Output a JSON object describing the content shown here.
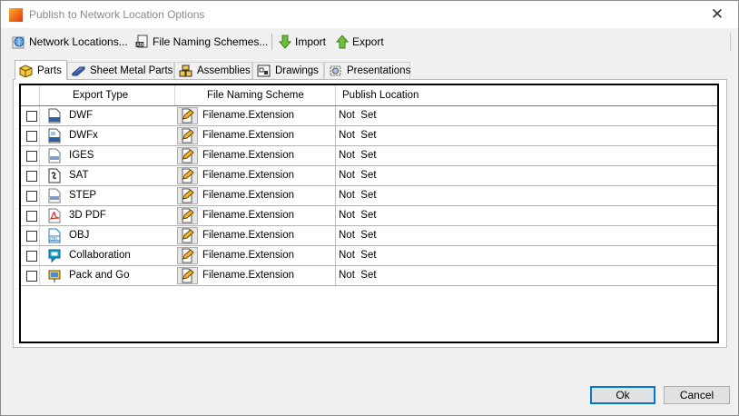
{
  "window": {
    "title": "Publish to Network Location Options",
    "close_glyph": "✕"
  },
  "toolbar": {
    "items": [
      {
        "label": "Network Locations...",
        "icon": "network-location-icon"
      },
      {
        "label": "File Naming Schemes...",
        "icon": "file-naming-icon"
      },
      {
        "label": "Import",
        "icon": "import-arrow-icon"
      },
      {
        "label": "Export",
        "icon": "export-arrow-icon"
      }
    ]
  },
  "tabs": [
    {
      "label": "Parts",
      "icon": "part-cube-icon",
      "active": true
    },
    {
      "label": "Sheet Metal Parts",
      "icon": "sheet-metal-icon",
      "active": false
    },
    {
      "label": "Assemblies",
      "icon": "assembly-icon",
      "active": false
    },
    {
      "label": "Drawings",
      "icon": "drawing-icon",
      "active": false
    },
    {
      "label": "Presentations",
      "icon": "presentation-icon",
      "active": false
    }
  ],
  "table": {
    "columns": [
      "Export Type",
      "File Naming Scheme",
      "Publish Location"
    ],
    "rows": [
      {
        "checked": false,
        "icon": "dwf-file-icon",
        "type": "DWF",
        "scheme": "Filename.Extension",
        "location": "Not  Set"
      },
      {
        "checked": false,
        "icon": "dwfx-file-icon",
        "type": "DWFx",
        "scheme": "Filename.Extension",
        "location": "Not  Set"
      },
      {
        "checked": false,
        "icon": "iges-file-icon",
        "type": "IGES",
        "scheme": "Filename.Extension",
        "location": "Not  Set"
      },
      {
        "checked": false,
        "icon": "sat-file-icon",
        "type": "SAT",
        "scheme": "Filename.Extension",
        "location": "Not  Set"
      },
      {
        "checked": false,
        "icon": "step-file-icon",
        "type": "STEP",
        "scheme": "Filename.Extension",
        "location": "Not  Set"
      },
      {
        "checked": false,
        "icon": "pdf-file-icon",
        "type": "3D PDF",
        "scheme": "Filename.Extension",
        "location": "Not  Set"
      },
      {
        "checked": false,
        "icon": "obj-file-icon",
        "type": "OBJ",
        "scheme": "Filename.Extension",
        "location": "Not  Set"
      },
      {
        "checked": false,
        "icon": "collaboration-icon",
        "type": "Collaboration",
        "scheme": "Filename.Extension",
        "location": "Not  Set"
      },
      {
        "checked": false,
        "icon": "pack-and-go-icon",
        "type": "Pack and Go",
        "scheme": "Filename.Extension",
        "location": "Not  Set"
      }
    ]
  },
  "buttons": {
    "ok": "Ok",
    "cancel": "Cancel"
  },
  "colors": {
    "accent": "#0078d7",
    "window_bg": "#f0f0f0"
  }
}
